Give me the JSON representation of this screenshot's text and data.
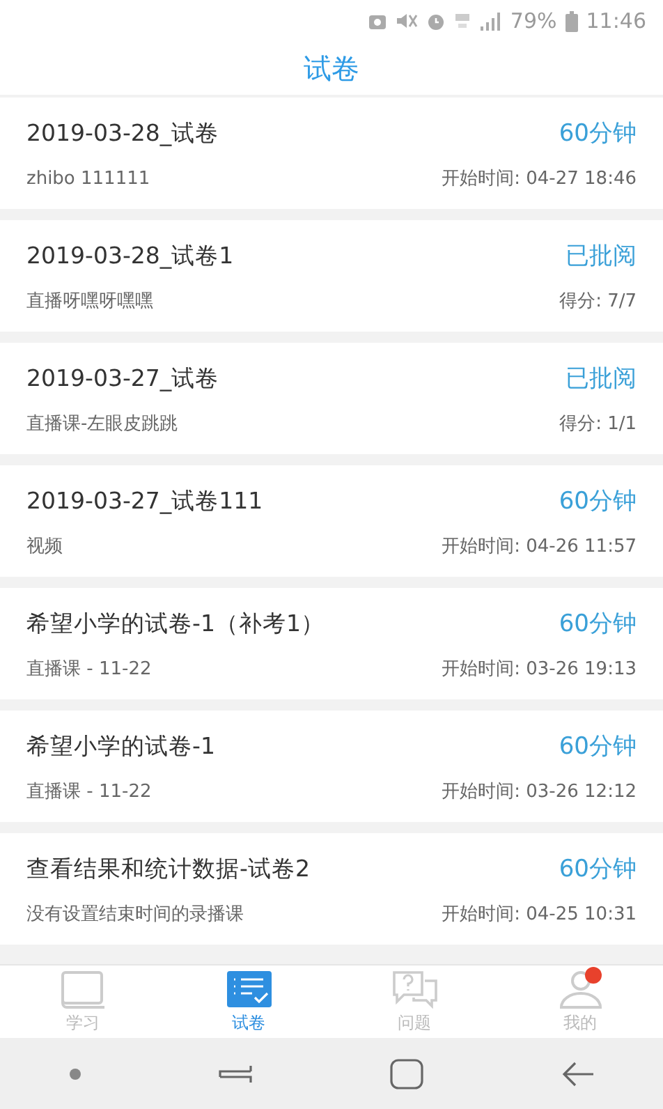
{
  "status_bar": {
    "battery": "79%",
    "time": "11:46"
  },
  "title": "试卷",
  "exams": [
    {
      "title": "2019-03-28_试卷",
      "tag": "60分钟",
      "subtitle": "zhibo 111111",
      "info": "开始时间: 04-27 18:46"
    },
    {
      "title": "2019-03-28_试卷1",
      "tag": "已批阅",
      "subtitle": "直播呀嘿呀嘿嘿",
      "info": "得分: 7/7"
    },
    {
      "title": "2019-03-27_试卷",
      "tag": "已批阅",
      "subtitle": "直播课-左眼皮跳跳",
      "info": "得分: 1/1"
    },
    {
      "title": "2019-03-27_试卷111",
      "tag": "60分钟",
      "subtitle": "视频",
      "info": "开始时间: 04-26 11:57"
    },
    {
      "title": "希望小学的试卷-1（补考1）",
      "tag": "60分钟",
      "subtitle": "直播课 - 11-22",
      "info": "开始时间: 03-26 19:13"
    },
    {
      "title": "希望小学的试卷-1",
      "tag": "60分钟",
      "subtitle": "直播课 - 11-22",
      "info": "开始时间: 03-26 12:12"
    },
    {
      "title": "查看结果和统计数据-试卷2",
      "tag": "60分钟",
      "subtitle": "没有设置结束时间的录播课",
      "info": "开始时间: 04-25 10:31"
    }
  ],
  "tabs": [
    {
      "kind": "study",
      "label": "学习",
      "selected": false,
      "badge": false
    },
    {
      "kind": "exam",
      "label": "试卷",
      "selected": true,
      "badge": false
    },
    {
      "kind": "question",
      "label": "问题",
      "selected": false,
      "badge": false
    },
    {
      "kind": "profile",
      "label": "我的",
      "selected": false,
      "badge": true
    }
  ]
}
